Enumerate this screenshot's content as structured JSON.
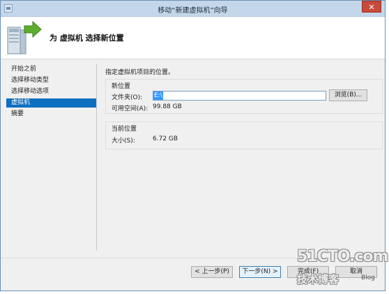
{
  "window": {
    "title": "移动“新建虚拟机”向导",
    "close_label": "✕",
    "header_title": "为 虚拟机 选择新位置"
  },
  "nav": {
    "items": [
      {
        "label": "开始之前"
      },
      {
        "label": "选择移动类型"
      },
      {
        "label": "选择移动选项"
      },
      {
        "label": "虚拟机"
      },
      {
        "label": "摘要"
      }
    ]
  },
  "content": {
    "instruction": "指定虚拟机项目的位置。",
    "new_location": {
      "title": "新位置",
      "folder_label": "文件夹(O):",
      "folder_value": "E:\\",
      "browse_label": "浏览(B)...",
      "free_space_label": "可用空间(A):",
      "free_space_value": "99.88 GB"
    },
    "current_location": {
      "title": "当前位置",
      "size_label": "大小(S):",
      "size_value": "6.72 GB"
    }
  },
  "buttons": {
    "previous": "< 上一步(P)",
    "next": "下一步(N) >",
    "finish": "完成(F)",
    "cancel": "取消"
  },
  "watermark": {
    "site": "51CTO.com",
    "tagline": "技术博客",
    "blog": "Blog"
  },
  "colors": {
    "title_bar": "#c4d7ea",
    "close_button": "#c74a3b",
    "selected_nav": "#0d6fc0",
    "arrow_green": "#5cae2c"
  }
}
